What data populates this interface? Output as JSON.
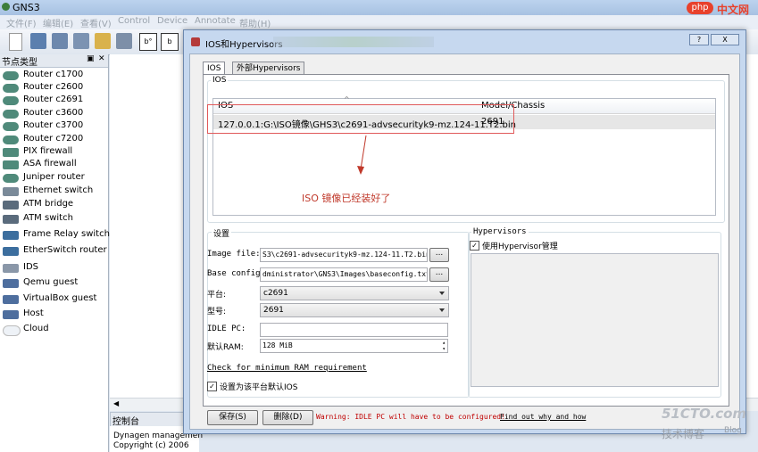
{
  "window": {
    "title": "GNS3"
  },
  "menu": [
    "文件(F)",
    "编辑(E)",
    "查看(V)",
    "Control",
    "Device",
    "Annotate",
    "帮助(H)"
  ],
  "node_panel": {
    "title": "节点类型",
    "items": [
      {
        "label": "Router c1700",
        "icon": "router-icon"
      },
      {
        "label": "Router c2600",
        "icon": "router-icon"
      },
      {
        "label": "Router c2691",
        "icon": "router-icon"
      },
      {
        "label": "Router c3600",
        "icon": "router-icon"
      },
      {
        "label": "Router c3700",
        "icon": "router-icon"
      },
      {
        "label": "Router c7200",
        "icon": "router-icon"
      },
      {
        "label": "PIX firewall",
        "icon": "firewall-icon"
      },
      {
        "label": "ASA firewall",
        "icon": "firewall-icon"
      },
      {
        "label": "Juniper router",
        "icon": "router-icon"
      },
      {
        "label": "Ethernet switch",
        "icon": "switch-icon"
      },
      {
        "label": "ATM bridge",
        "icon": "atm-bridge-icon"
      },
      {
        "label": "ATM switch",
        "icon": "atm-switch-icon"
      },
      {
        "label": "Frame Relay switch",
        "icon": "frame-relay-icon"
      },
      {
        "label": "EtherSwitch router",
        "icon": "etherswitch-icon"
      },
      {
        "label": "IDS",
        "icon": "ids-icon"
      },
      {
        "label": "Qemu guest",
        "icon": "computer-icon"
      },
      {
        "label": "VirtualBox guest",
        "icon": "computer-icon"
      },
      {
        "label": "Host",
        "icon": "computer-icon"
      },
      {
        "label": "Cloud",
        "icon": "cloud-icon"
      }
    ]
  },
  "console": {
    "title": "控制台",
    "lines": [
      "Dynagen managemen",
      "Copyright (c) 2006"
    ]
  },
  "dialog": {
    "title": "IOS和Hypervisors",
    "tabs": [
      "IOS",
      "外部Hypervisors"
    ],
    "ios_group": "IOS",
    "table": {
      "columns": [
        "IOS",
        "Model/Chassis"
      ],
      "rows": [
        {
          "ios": "127.0.0.1:G:\\ISO镜像\\GHS3\\c2691-advsecurityk9-mz.124-11.T2.bin",
          "model": "2691"
        }
      ]
    },
    "annotation": "ISO 镜像已经装好了",
    "settings": {
      "group": "设置",
      "image_file_label": "Image file:",
      "image_file_value": "S3\\c2691-advsecurityk9-mz.124-11.T2.bin",
      "base_config_label": "Base config:",
      "base_config_value": "dministrator\\GNS3\\Images\\baseconfig.txt",
      "browse": "...",
      "platform_label": "平台:",
      "platform_value": "c2691",
      "model_label": "型号:",
      "model_value": "2691",
      "idle_pc_label": "IDLE PC:",
      "idle_pc_value": "",
      "ram_label": "默认RAM:",
      "ram_value": "128 MiB",
      "check_ram_link": "Check for minimum RAM requirement",
      "default_checkbox": "设置为该平台默认IOS"
    },
    "hypervisor": {
      "group": "Hypervisors",
      "checkbox": "使用Hypervisor管理"
    },
    "buttons": {
      "save": "保存(S)",
      "delete": "删除(D)"
    },
    "warning": "Warning: IDLE PC will have to be configured!",
    "warning_link": "Find out why and how",
    "close_button": "X",
    "help_button": "?"
  },
  "watermarks": {
    "php": "中文网",
    "site": "51CTO.com",
    "blog_cn": "技术博客",
    "blog": "Blog"
  }
}
